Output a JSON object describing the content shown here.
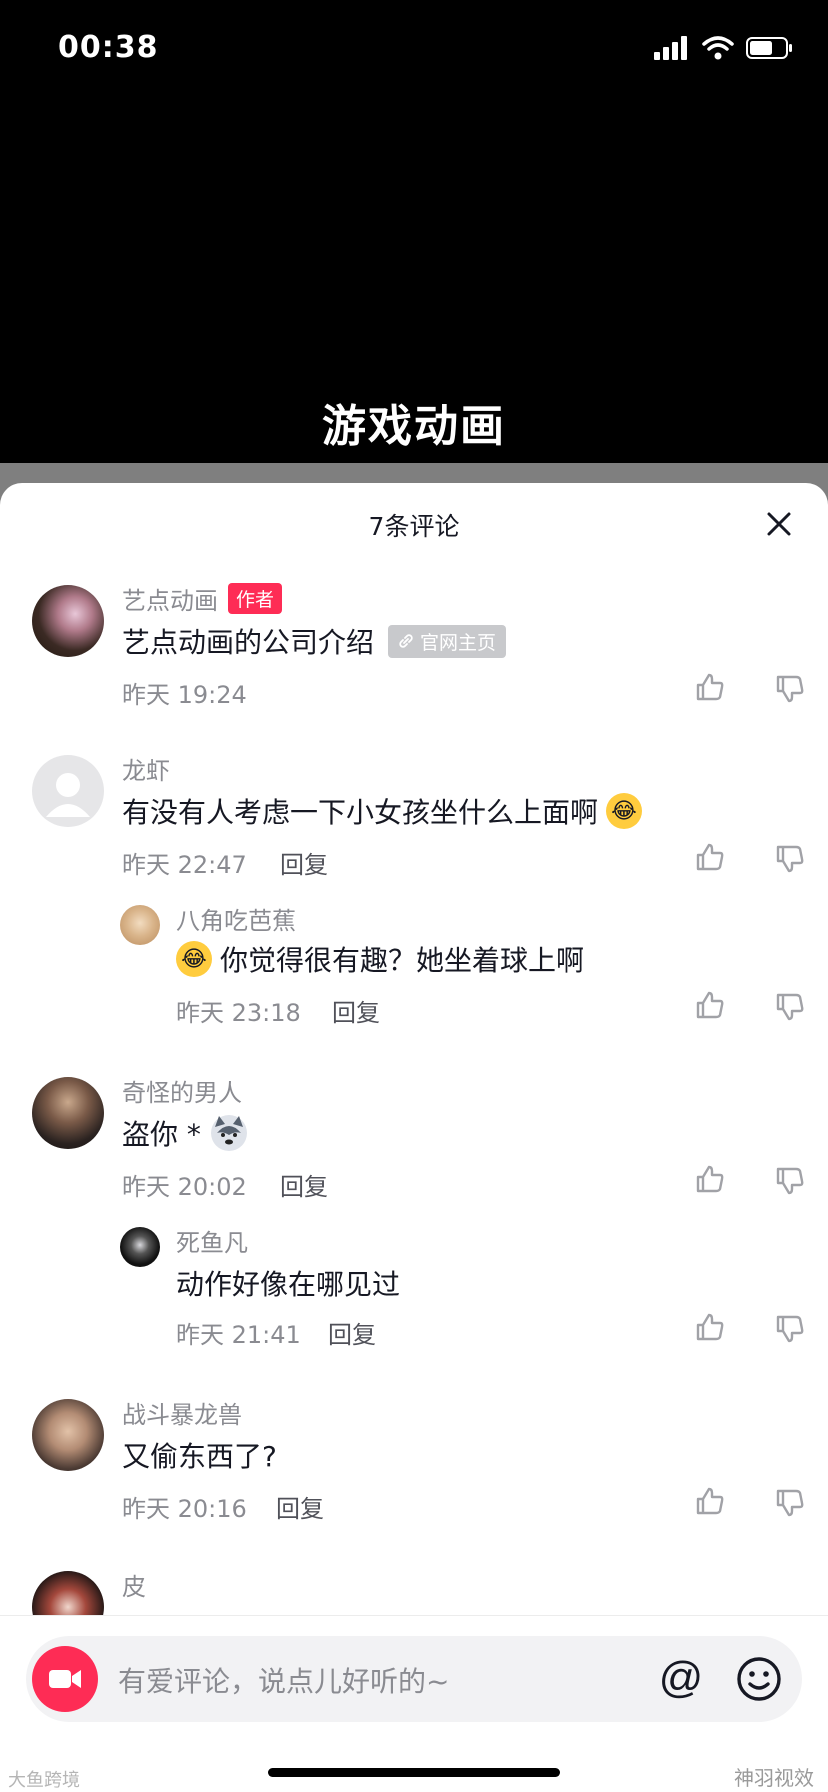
{
  "status": {
    "time": "00:38"
  },
  "video": {
    "caption": "游戏动画"
  },
  "sheet": {
    "title": "7条评论"
  },
  "comments": [
    {
      "name": "艺点动画",
      "badge": "作者",
      "text": "艺点动画的公司介绍",
      "tag": "官网主页",
      "time": "昨天 19:24"
    },
    {
      "name": "龙虾",
      "text": "有没有人考虑一下小女孩坐什么上面啊",
      "time": "昨天 22:47",
      "reply": "回复"
    },
    {
      "name": "八角吃芭蕉",
      "text": "你觉得很有趣？她坐着球上啊",
      "time": "昨天 23:18",
      "reply": "回复"
    },
    {
      "name": "奇怪的男人",
      "text": "盗你 *",
      "time": "昨天 20:02",
      "reply": "回复"
    },
    {
      "name": "死鱼凡",
      "text": "动作好像在哪见过",
      "time": "昨天 21:41",
      "reply": "回复"
    },
    {
      "name": "战斗暴龙兽",
      "text": "又偷东西了?",
      "time": "昨天 20:16",
      "reply": "回复"
    },
    {
      "name": "皮"
    }
  ],
  "input": {
    "placeholder": "有爱评论，说点儿好听的~",
    "at_symbol": "@"
  },
  "watermarks": {
    "left": "大鱼跨境",
    "right": "神羽视效"
  },
  "colors": {
    "accent": "#fe2c55",
    "meta": "#8a8b91",
    "text": "#161823"
  }
}
